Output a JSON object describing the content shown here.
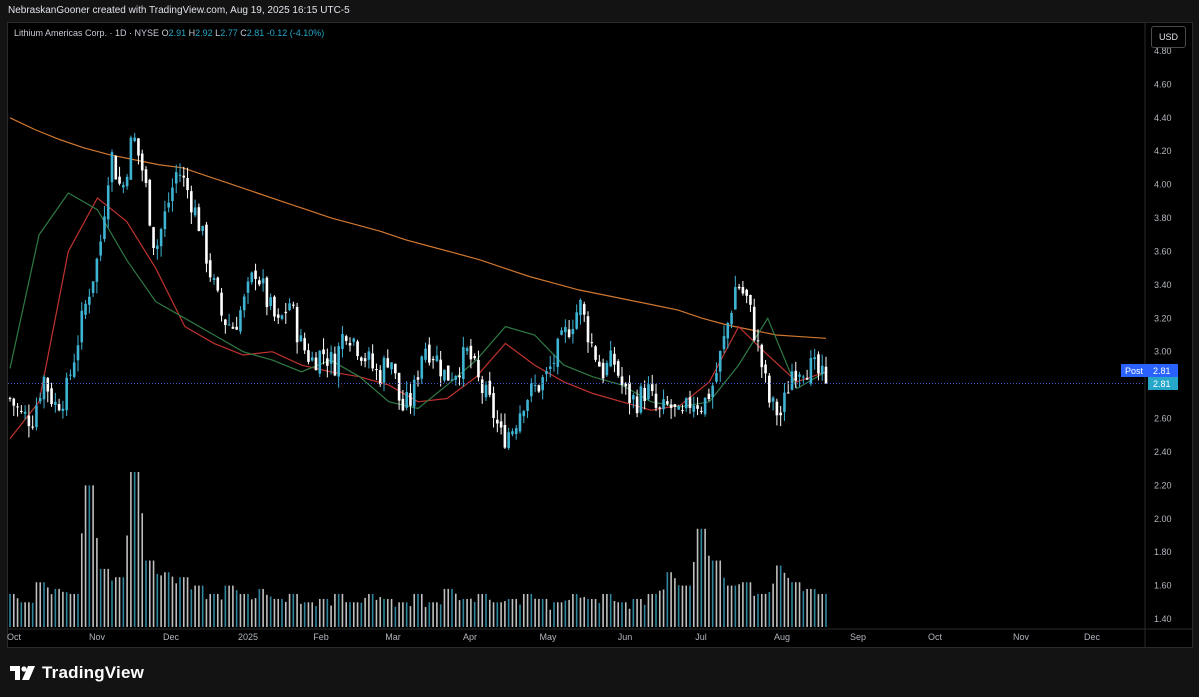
{
  "header": {
    "caption": "NebraskanGooner created with TradingView.com, Aug 19, 2025 16:15 UTC-5"
  },
  "legend": {
    "symbol": "Lithium Americas Corp. · 1D · NYSE",
    "open_label": "O",
    "open": "2.91",
    "high_label": "H",
    "high": "2.92",
    "low_label": "L",
    "low": "2.77",
    "close_label": "C",
    "close": "2.81",
    "change": "-0.12 (-4.10%)"
  },
  "currency_button": "USD",
  "price_badges": {
    "post_label": "Post",
    "post_value": "2.81",
    "last_value": "2.81"
  },
  "brand": {
    "name": "TradingView"
  },
  "colors": {
    "up": "#3fb3d3",
    "down": "#ffffff",
    "ma_long": "#d0772f",
    "ma_mid": "#c0332f",
    "ma_short": "#2f7a45",
    "axis_text": "#b2b5be",
    "price_line": "#3b55c9"
  },
  "chart_data": {
    "type": "candlestick",
    "interval": "1D",
    "x_tick_labels": [
      "Oct",
      "Nov",
      "Dec",
      "2025",
      "Feb",
      "Mar",
      "Apr",
      "May",
      "Jun",
      "Jul",
      "Aug",
      "Sep",
      "Oct",
      "Nov",
      "Dec"
    ],
    "y_tick_labels": [
      "4.80",
      "4.60",
      "4.40",
      "4.20",
      "4.00",
      "3.80",
      "3.60",
      "3.40",
      "3.20",
      "3.00",
      "2.80",
      "2.60",
      "2.40",
      "2.20",
      "2.00",
      "1.80",
      "1.60",
      "1.40"
    ],
    "ylim": [
      1.4,
      4.8
    ],
    "grid": false,
    "last_close": 2.81,
    "path": [
      2.72,
      2.62,
      2.6,
      2.85,
      2.68,
      2.75,
      3.05,
      3.35,
      3.6,
      4.2,
      3.95,
      4.3,
      4.05,
      3.6,
      3.85,
      4.1,
      3.95,
      3.75,
      3.45,
      3.2,
      3.15,
      3.3,
      3.5,
      3.3,
      3.15,
      3.3,
      3.05,
      2.95,
      3.0,
      2.92,
      3.15,
      3.05,
      2.95,
      2.85,
      3.0,
      2.65,
      2.72,
      3.05,
      2.98,
      2.85,
      2.9,
      3.0,
      2.8,
      2.68,
      2.48,
      2.55,
      2.72,
      2.78,
      2.85,
      3.0,
      3.15,
      3.28,
      3.05,
      2.88,
      2.95,
      2.75,
      2.7,
      2.78,
      2.62,
      2.68,
      2.58,
      2.72,
      2.68,
      2.82,
      3.1,
      3.42,
      3.3,
      3.0,
      2.68,
      2.62,
      2.9,
      2.92,
      2.89,
      2.81
    ],
    "moving_averages": [
      {
        "name": "MA long",
        "color": "#d0772f",
        "values": [
          4.4,
          4.33,
          4.27,
          4.22,
          4.18,
          4.15,
          4.12,
          4.1,
          4.05,
          4.0,
          3.95,
          3.9,
          3.85,
          3.8,
          3.76,
          3.72,
          3.67,
          3.63,
          3.59,
          3.55,
          3.5,
          3.45,
          3.41,
          3.37,
          3.34,
          3.31,
          3.28,
          3.25,
          3.2,
          3.16,
          3.13,
          3.1,
          3.09,
          3.08
        ]
      },
      {
        "name": "MA mid",
        "color": "#c0332f",
        "values": [
          2.48,
          2.7,
          3.6,
          3.92,
          3.78,
          3.5,
          3.15,
          3.05,
          2.98,
          3.0,
          2.92,
          2.88,
          2.85,
          2.8,
          2.7,
          2.72,
          2.85,
          3.05,
          2.92,
          2.82,
          2.75,
          2.7,
          2.65,
          2.68,
          2.82,
          3.15,
          2.98,
          2.82,
          2.88
        ]
      },
      {
        "name": "MA short",
        "color": "#2f7a45",
        "values": [
          2.9,
          3.7,
          3.95,
          3.85,
          3.55,
          3.3,
          3.2,
          3.1,
          3.0,
          2.95,
          2.88,
          2.95,
          2.85,
          2.7,
          2.66,
          2.8,
          2.95,
          3.15,
          3.1,
          2.92,
          2.85,
          2.8,
          2.7,
          2.67,
          2.7,
          2.92,
          3.2,
          2.78,
          2.88
        ]
      }
    ],
    "volume": {
      "ylim": [
        1.4,
        2.3
      ],
      "levels": [
        1.55,
        1.5,
        1.62,
        1.58,
        1.55,
        2.2,
        1.7,
        1.65,
        2.28,
        1.75,
        1.68,
        1.65,
        1.6,
        1.55,
        1.6,
        1.55,
        1.58,
        1.52,
        1.55,
        1.5,
        1.52,
        1.55,
        1.5,
        1.55,
        1.52,
        1.5,
        1.55,
        1.5,
        1.58,
        1.52,
        1.55,
        1.5,
        1.52,
        1.55,
        1.52,
        1.5,
        1.55,
        1.52,
        1.55,
        1.5,
        1.52,
        1.55,
        1.68,
        1.6,
        1.94,
        1.75,
        1.6,
        1.62,
        1.55,
        1.72,
        1.62,
        1.58,
        1.55
      ]
    }
  }
}
